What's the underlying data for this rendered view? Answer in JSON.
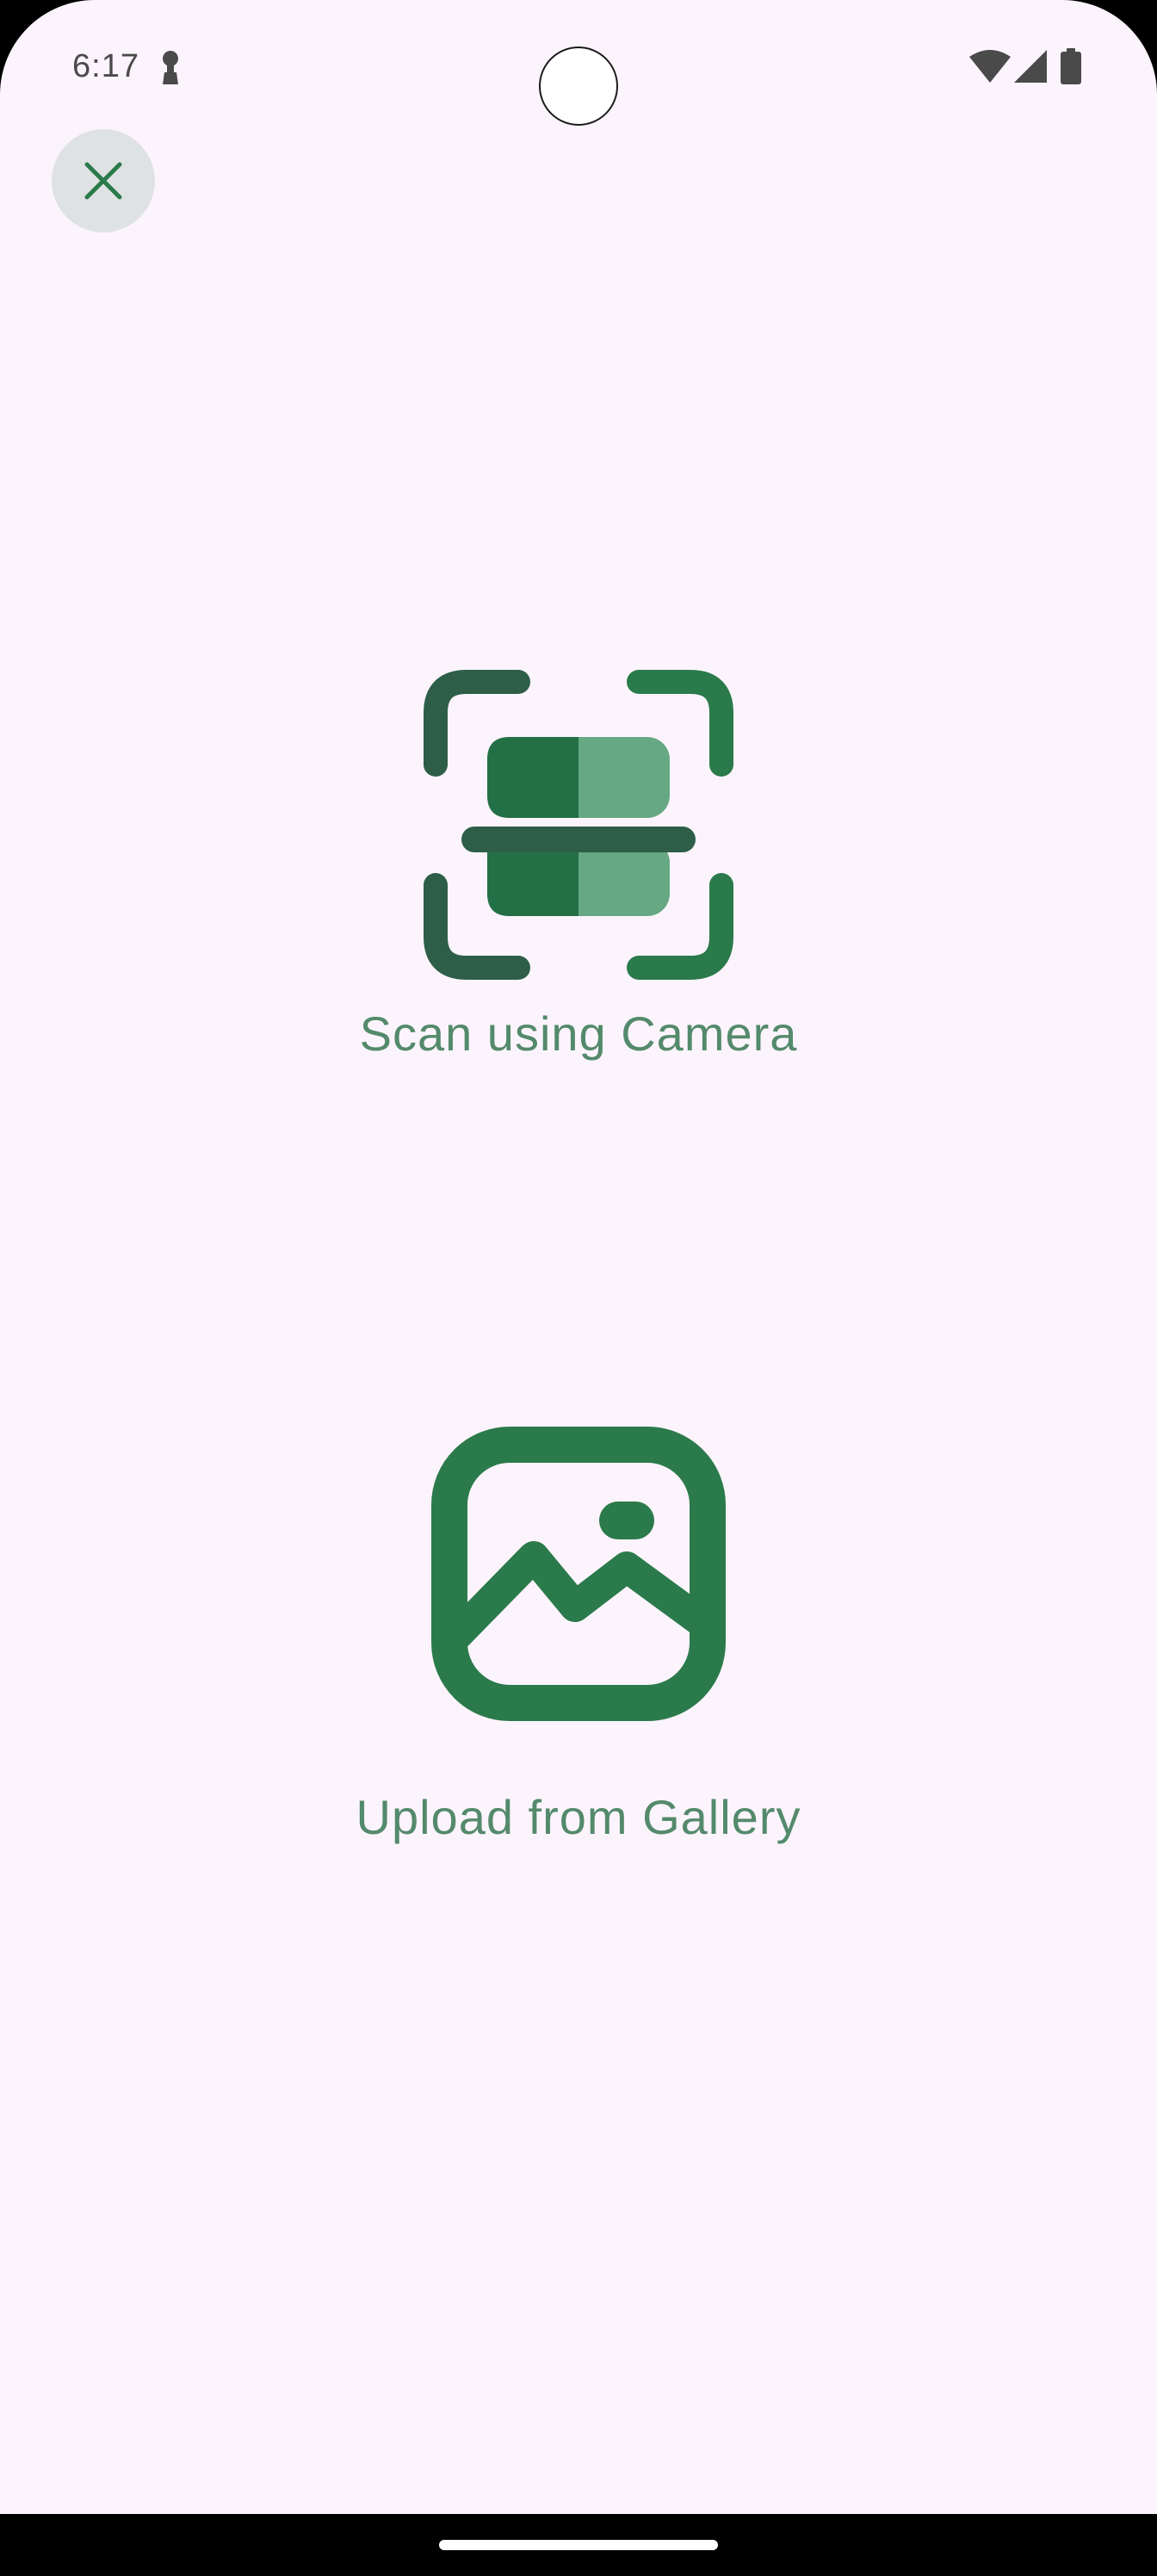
{
  "status_bar": {
    "time": "6:17",
    "icons": [
      "key-icon",
      "wifi-icon",
      "cellular-signal-icon",
      "battery-icon"
    ]
  },
  "close_button": {
    "icon": "close-icon"
  },
  "options": {
    "scan": {
      "label": "Scan using Camera",
      "icon": "document-scanner-icon"
    },
    "upload": {
      "label": "Upload from Gallery",
      "icon": "gallery-image-icon"
    }
  },
  "colors": {
    "background": "#fcf4fc",
    "accent": "#2b7a4b",
    "label": "#548a6c",
    "close_button_bg": "#dfe2e3"
  }
}
